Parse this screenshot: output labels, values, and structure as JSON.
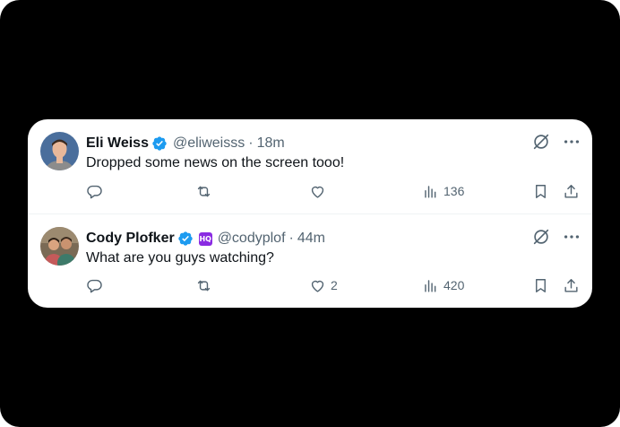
{
  "tweets": [
    {
      "name": "Eli Weiss",
      "handle": "@eliweisss",
      "separator": "·",
      "time": "18m",
      "text": "Dropped some news on the screen tooo!",
      "verified": true,
      "affiliation_badge": null,
      "actions": {
        "reply_count": "",
        "retweet_count": "",
        "like_count": "",
        "view_count": "136"
      },
      "avatar_colors": {
        "bg": "#4a6e9c",
        "skin": "#e8b89a",
        "shirt": "#8c8c8c"
      }
    },
    {
      "name": "Cody Plofker",
      "handle": "@codyplof",
      "separator": "·",
      "time": "44m",
      "text": "What are you guys watching?",
      "verified": true,
      "affiliation_badge": "HQ",
      "actions": {
        "reply_count": "",
        "retweet_count": "",
        "like_count": "2",
        "view_count": "420"
      },
      "avatar_colors": {
        "bg": "#7a6a55",
        "skin": "#d9a47f",
        "shirt": "#3d7a6a"
      }
    }
  ],
  "icons": {
    "verified": "verified-badge-icon",
    "grok": "grok-icon",
    "more": "more-icon",
    "reply": "reply-icon",
    "retweet": "retweet-icon",
    "like": "heart-icon",
    "views": "views-icon",
    "bookmark": "bookmark-icon",
    "share": "share-icon"
  },
  "colors": {
    "background": "#000000",
    "card": "#ffffff",
    "text": "#0f1419",
    "secondary": "#536471",
    "verified": "#1d9bf0",
    "divider": "#eff3f4"
  }
}
